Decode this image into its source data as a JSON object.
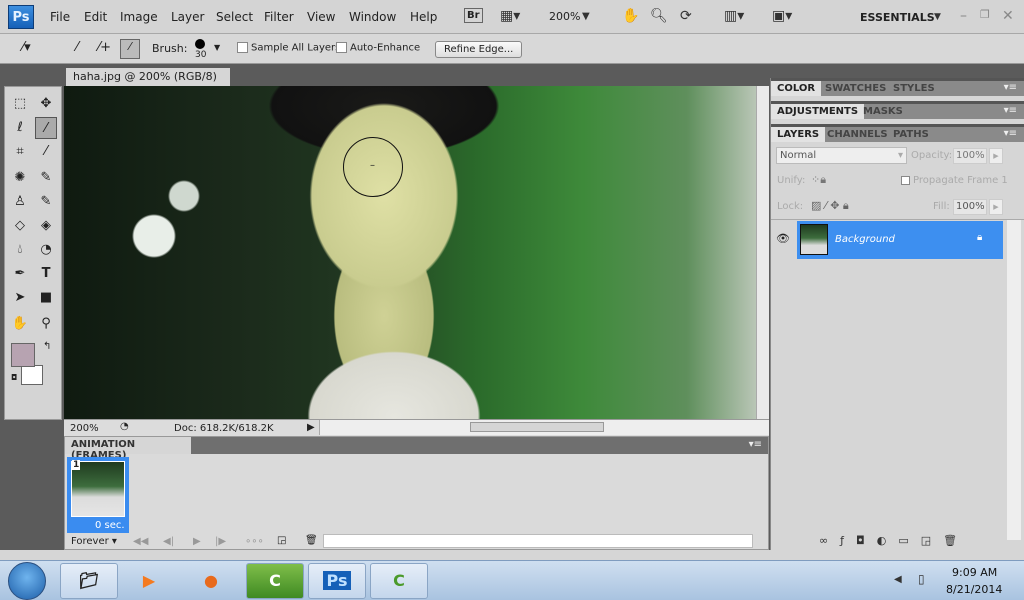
{
  "app": {
    "logo": "Ps",
    "menus": [
      "File",
      "Edit",
      "Image",
      "Layer",
      "Select",
      "Filter",
      "View",
      "Window",
      "Help"
    ],
    "bridge": "Br",
    "zoom": "200%",
    "workspace": "ESSENTIALS"
  },
  "options": {
    "brush_label": "Brush:",
    "brush_size": "30",
    "sample_all_layers": "Sample All Layers",
    "auto_enhance": "Auto-Enhance",
    "refine_edge": "Refine Edge..."
  },
  "document": {
    "tab_title": "haha.jpg @ 200% (RGB/8)",
    "close": "×",
    "zoom": "200%",
    "doc_size": "Doc: 618.2K/618.2K"
  },
  "animation": {
    "tab": "ANIMATION (FRAMES)",
    "frame_number": "1",
    "frame_delay": "0 sec.",
    "loop": "Forever"
  },
  "panels": {
    "group1": [
      "COLOR",
      "SWATCHES",
      "STYLES"
    ],
    "group2": [
      "ADJUSTMENTS",
      "MASKS"
    ],
    "group3": [
      "LAYERS",
      "CHANNELS",
      "PATHS"
    ],
    "blend_mode": "Normal",
    "opacity_label": "Opacity:",
    "opacity": "100%",
    "unify_label": "Unify:",
    "propagate": "Propagate Frame 1",
    "lock_label": "Lock:",
    "fill_label": "Fill:",
    "fill": "100%",
    "layer_name": "Background"
  },
  "colors": {
    "foreground": "#b7a3b1",
    "background": "#ffffff",
    "selection": "#3d8ff0"
  },
  "taskbar": {
    "time": "9:09 AM",
    "date": "8/21/2014",
    "ps": "Ps",
    "camtasia": "C"
  }
}
